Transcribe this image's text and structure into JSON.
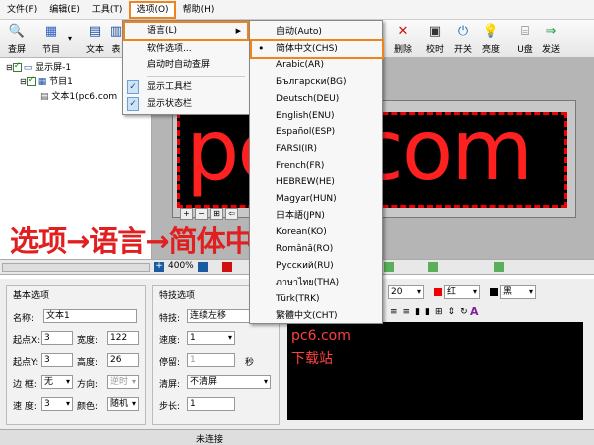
{
  "menubar": [
    "文件(F)",
    "编辑(E)",
    "工具(T)",
    "选项(O)",
    "帮助(H)"
  ],
  "toolbar_left": [
    {
      "label": "查屏",
      "icon": "magnifier"
    },
    {
      "label": "节目",
      "icon": "program"
    },
    {
      "label": "文本",
      "icon": "text"
    },
    {
      "label": "表",
      "icon": "table"
    }
  ],
  "toolbar_right": [
    {
      "label": "删除",
      "icon": "delete"
    },
    {
      "label": "校时",
      "icon": "clock"
    },
    {
      "label": "开关",
      "icon": "power"
    },
    {
      "label": "亮度",
      "icon": "bulb"
    },
    {
      "label": "U盘",
      "icon": "usb"
    },
    {
      "label": "发送",
      "icon": "send"
    }
  ],
  "tree": {
    "screen": "显示屏-1",
    "program": "节目1",
    "text": "文本1(pc6.com"
  },
  "options_menu": {
    "items": [
      "语言(L)",
      "软件选项...",
      "启动时自动查屏",
      "显示工具栏",
      "显示状态栏"
    ]
  },
  "language_menu": {
    "items": [
      "自动(Auto)",
      "简体中文(CHS)",
      "Arabic(AR)",
      "Български(BG)",
      "Deutsch(DEU)",
      "English(ENU)",
      "Español(ESP)",
      "FARSI(IR)",
      "French(FR)",
      "HEBREW(HE)",
      "Magyar(HUN)",
      "日本語(JPN)",
      "Korean(KO)",
      "Română(RO)",
      "Русский(RU)",
      "ภาษาไทย(THA)",
      "Türk(TRK)",
      "繁體中文(CHT)"
    ],
    "selected": "简体中文(CHS)"
  },
  "led": {
    "text": "pc6.com"
  },
  "caption": "选项→语言→简体中文",
  "midbar": {
    "zoom": "400%"
  },
  "basic": {
    "title": "基本选项",
    "name_label": "名称:",
    "name_value": "文本1",
    "x_label": "起点X:",
    "x_value": "3",
    "width_label": "宽度:",
    "width_value": "122",
    "y_label": "起点Y:",
    "y_value": "3",
    "height_label": "高度:",
    "height_value": "26",
    "border_label": "边 框:",
    "border_value": "无",
    "dir_label": "方向:",
    "dir_value": "逆时",
    "speed_label": "速 度:",
    "speed_value": "3",
    "color_label": "颜色:",
    "color_value": "随机"
  },
  "effect": {
    "title": "特技选项",
    "effect_label": "特技:",
    "effect_value": "连续左移",
    "speed_label": "速度:",
    "speed_value": "1",
    "stay_label": "停留:",
    "stay_value": "1",
    "stay_unit": "秒",
    "clear_label": "清屏:",
    "clear_value": "不清屏",
    "step_label": "步长:",
    "step_value": "1"
  },
  "text_toolbar": {
    "font_size": "20",
    "fg_color": "红",
    "bg_color": "黑"
  },
  "editor": {
    "line1": "pc6.com",
    "line2": "下载站"
  },
  "status": "未连接",
  "colors": {
    "orange": "#f0841c",
    "led_red": "#ff2020"
  }
}
